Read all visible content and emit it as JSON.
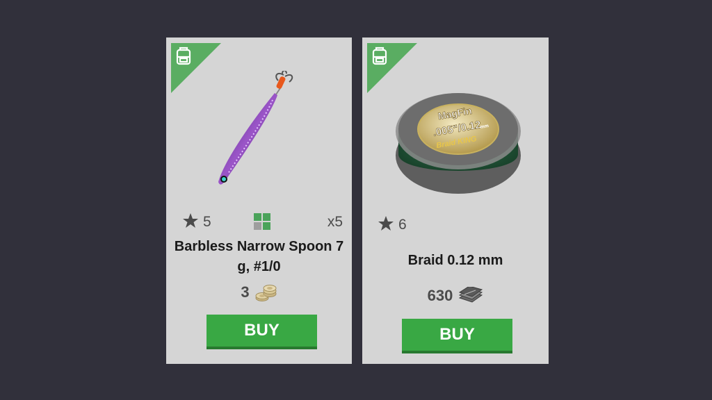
{
  "colors": {
    "background": "#31303b",
    "card": "#d5d5d5",
    "accent_green": "#39a844",
    "text_dark": "#1a1a1a",
    "text_gray": "#4b4b4b"
  },
  "products": [
    {
      "badge_icon": "backpack-icon",
      "image": "fishing-spoon-lure",
      "rank_icon": "star-icon",
      "rank": "5",
      "category_icon": "inventory-grid-icon",
      "quantity": "x5",
      "name": "Barbless Narrow Spoon 7 g, #1/0",
      "price": "3",
      "currency_icon": "gold-coins-icon",
      "buy_label": "BUY"
    },
    {
      "badge_icon": "backpack-icon",
      "image": "braided-line-spool",
      "spool_brand": "MagFin",
      "spool_spec": ".005\"/0.12",
      "spool_unit": "mm",
      "spool_model": "Braid KING",
      "rank_icon": "star-icon",
      "rank": "6",
      "name": "Braid 0.12 mm",
      "price": "630",
      "currency_icon": "silver-banknotes-icon",
      "buy_label": "BUY"
    }
  ]
}
